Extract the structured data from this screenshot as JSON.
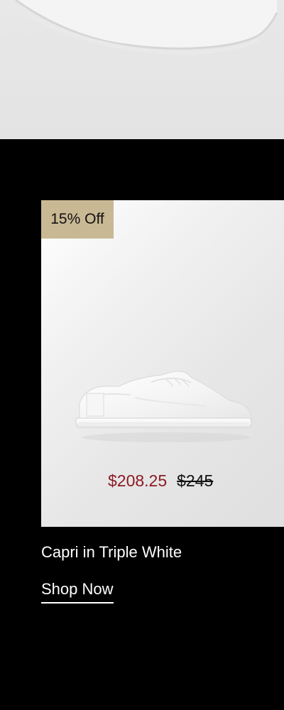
{
  "product": {
    "badge": "15% Off",
    "sale_price": "$208.25",
    "original_price": "$245",
    "name": "Capri in Triple White",
    "cta": "Shop Now",
    "colors": {
      "badge_bg": "#c9b894",
      "sale_price": "#8b1a25",
      "page_bg": "#000000"
    }
  }
}
